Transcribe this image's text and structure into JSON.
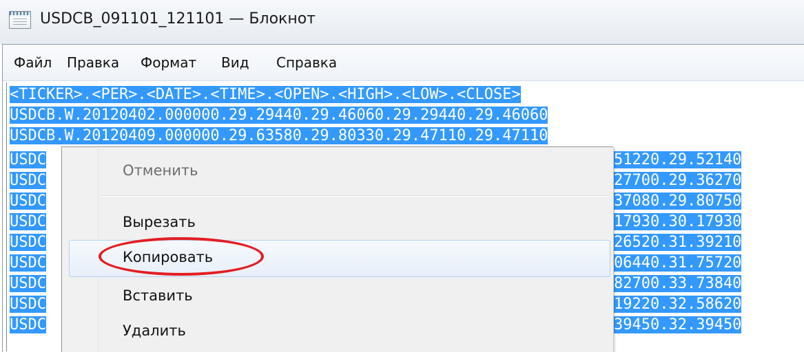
{
  "window": {
    "title": "USDCB_091101_121101 — Блокнот"
  },
  "menu": {
    "items": [
      "Файл",
      "Правка",
      "Формат",
      "Вид",
      "Справка"
    ]
  },
  "editor": {
    "lines": [
      "<TICKER>.<PER>.<DATE>.<TIME>.<OPEN>.<HIGH>.<LOW>.<CLOSE>",
      "USDCB.W.20120402.000000.29.29440.29.46060.29.29440.29.46060",
      "USDCB.W.20120409.000000.29.63580.29.80330.29.47110.29.47110"
    ],
    "partial_left": [
      "USDC",
      "USDC",
      "USDC",
      "USDC",
      "USDC",
      "USDC",
      "USDC",
      "USDC",
      "USDC"
    ],
    "partial_right": [
      "51220.29.52140",
      "27700.29.36270",
      "37080.29.80750",
      "17930.30.17930",
      "26520.31.39210",
      "06440.31.75720",
      "82700.33.73840",
      "19220.32.58620",
      "39450.32.39450"
    ]
  },
  "context_menu": {
    "items": [
      {
        "label": "Отменить",
        "enabled": false
      },
      {
        "label": "Вырезать",
        "enabled": true
      },
      {
        "label": "Копировать",
        "enabled": true,
        "highlighted": true
      },
      {
        "label": "Вставить",
        "enabled": true
      },
      {
        "label": "Удалить",
        "enabled": true
      }
    ]
  },
  "colors": {
    "selection": "#3399ff",
    "annotation": "#e31e24"
  }
}
